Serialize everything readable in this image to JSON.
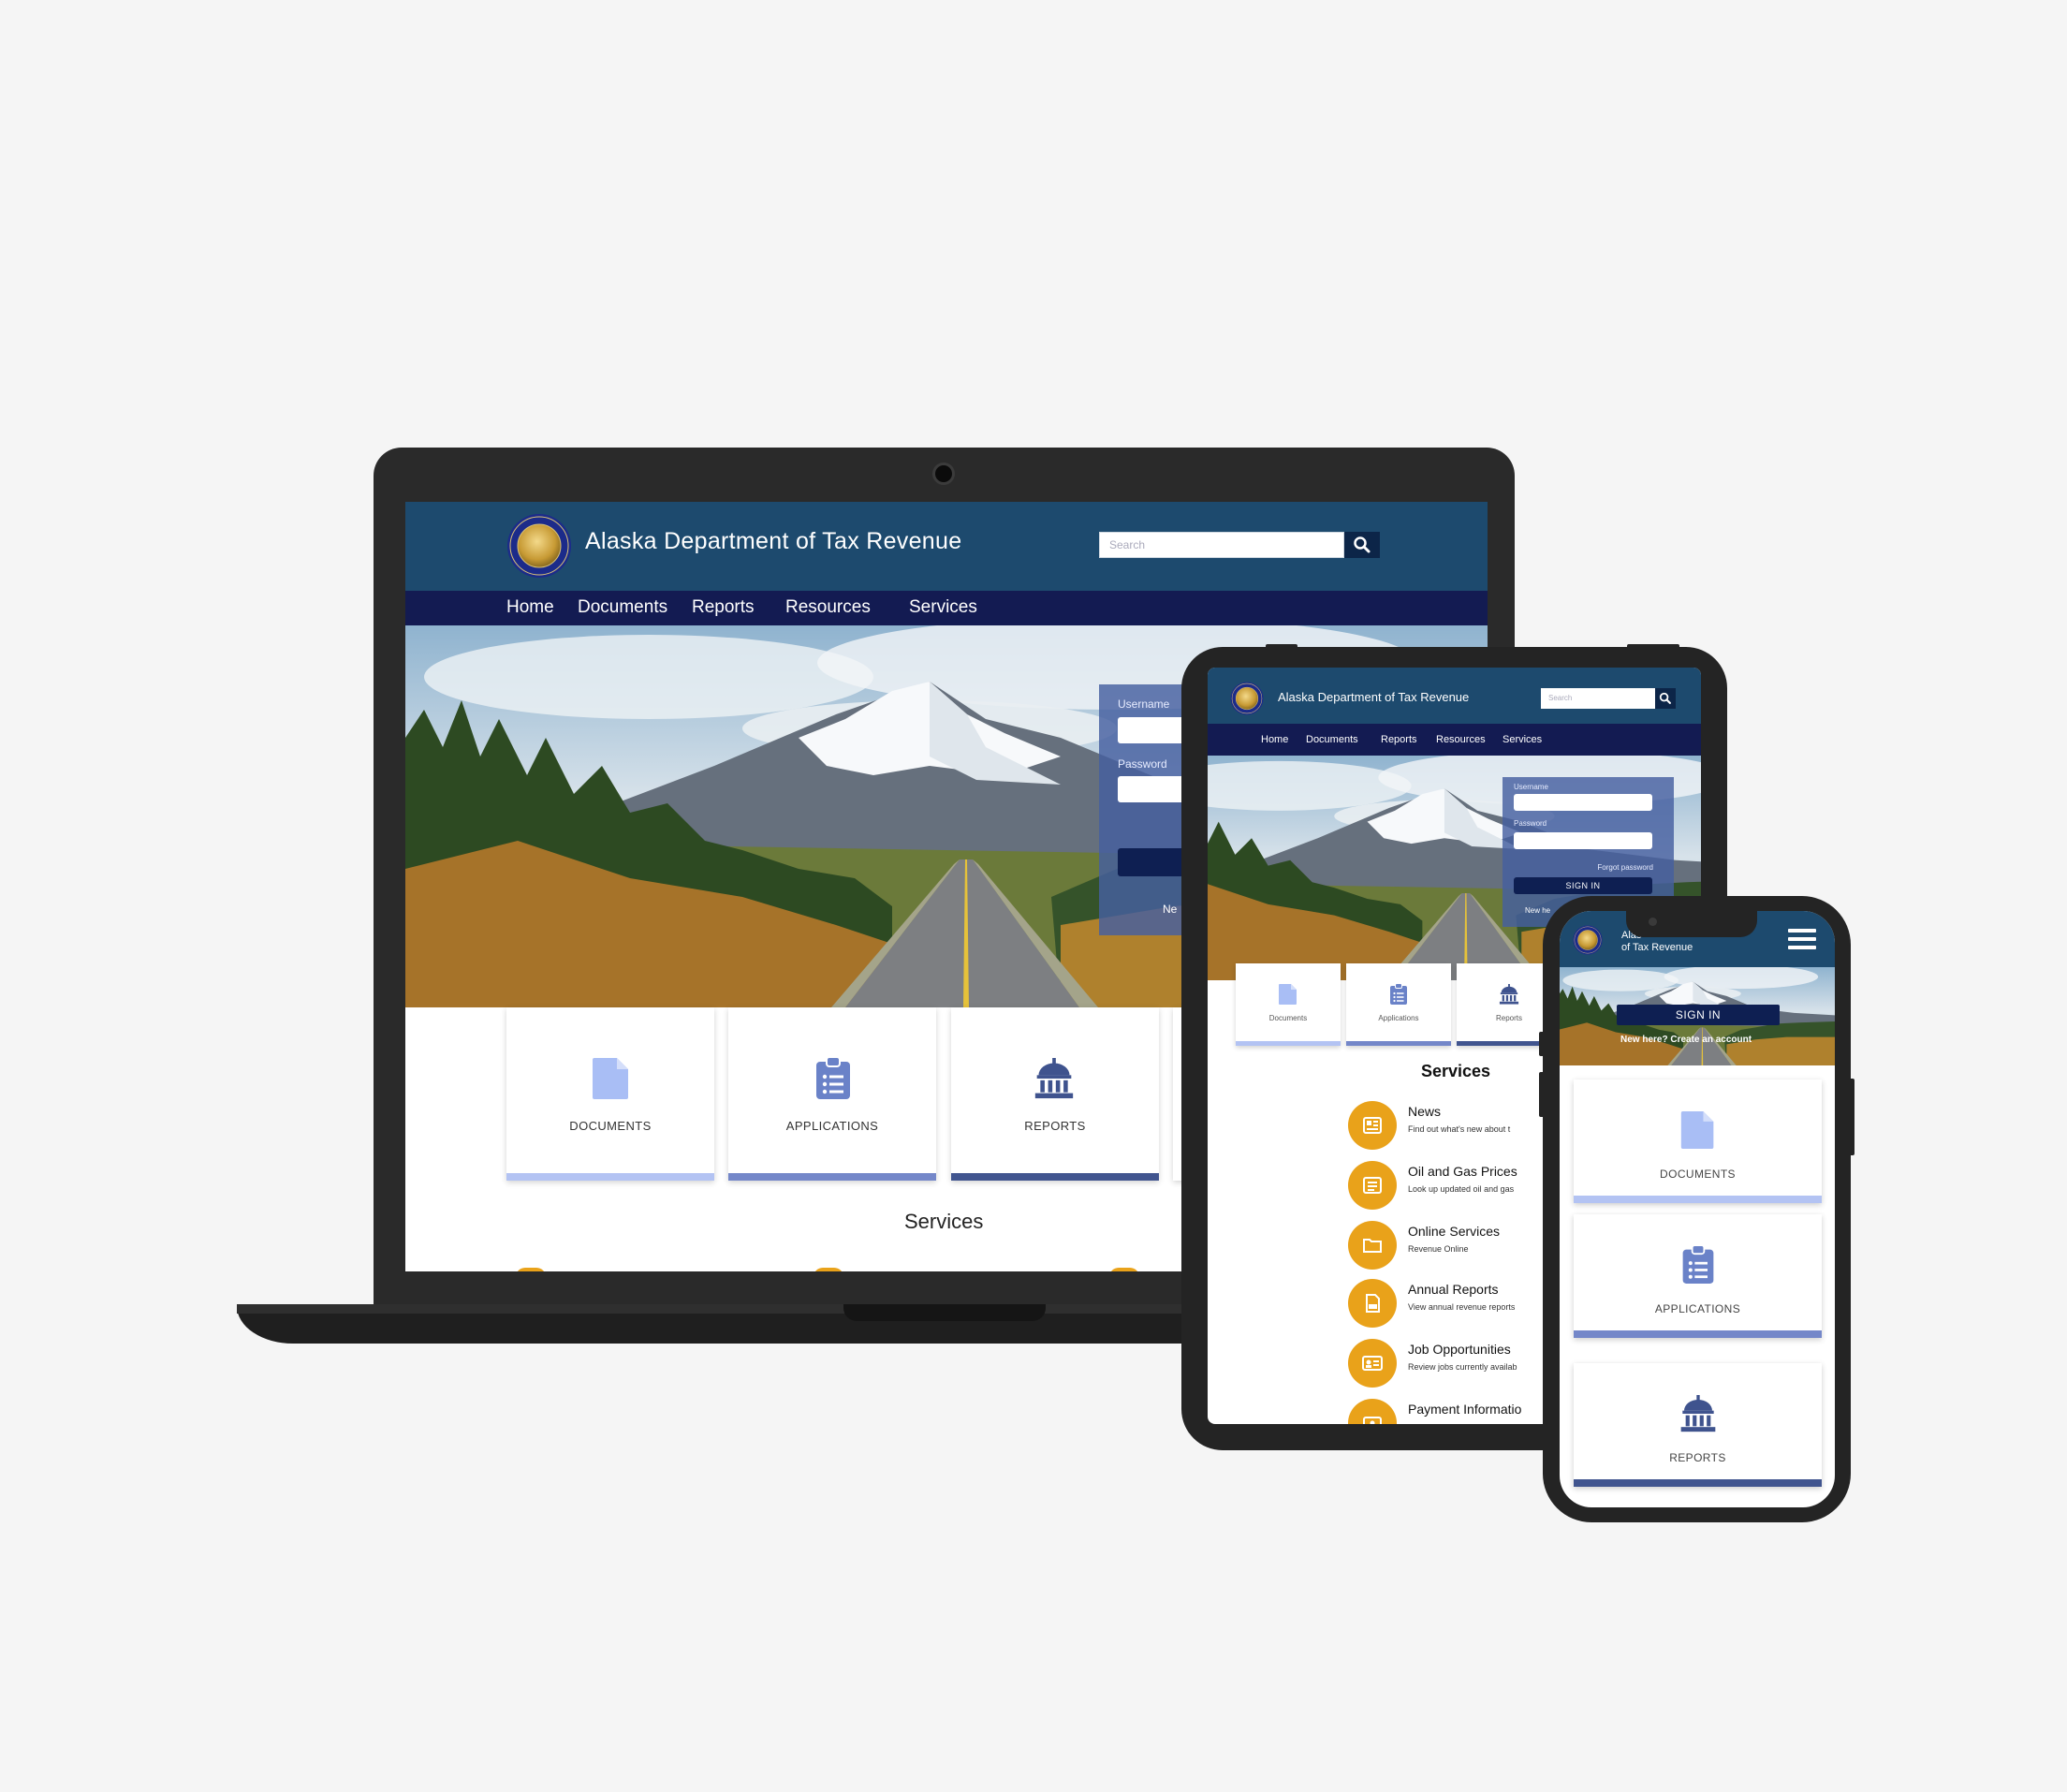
{
  "site": {
    "title": "Alaska Department of Tax Revenue",
    "phone_title_line1": "Alas",
    "phone_title_line2": "of Tax Revenue",
    "search_placeholder": "Search"
  },
  "nav": [
    "Home",
    "Documents",
    "Reports",
    "Resources",
    "Services"
  ],
  "login": {
    "username_label": "Username",
    "password_label": "Password",
    "forgot": "Forgot password",
    "sign_in": "SIGN IN",
    "new_here_short": "Ne",
    "new_here_tablet": "New he",
    "new_here_full": "New here? Create an account"
  },
  "cards": {
    "documents": "DOCUMENTS",
    "applications": "APPLICATIONS",
    "reports": "REPORTS",
    "documents_small": "Documents",
    "applications_small": "Applications",
    "reports_small": "Reports"
  },
  "services_heading": "Services",
  "services": [
    {
      "title": "News",
      "desc": "Find out what's new about t"
    },
    {
      "title": "Oil and Gas Prices",
      "desc": "Look up updated oil and gas"
    },
    {
      "title": "Online Services",
      "desc": "Revenue Online"
    },
    {
      "title": "Annual Reports",
      "desc": "View annual revenue reports"
    },
    {
      "title": "Job Opportunities",
      "desc": "Review jobs currently availab"
    },
    {
      "title": "Payment Informatio",
      "desc": ""
    }
  ],
  "colors": {
    "header_blue": "#1d4a6e",
    "nav_navy": "#131b52",
    "accent_orange": "#e9a21a",
    "doc_icon": "#a9bef5",
    "app_icon": "#6a82c8",
    "rep_icon": "#3f538e"
  },
  "icons": {
    "search": "magnifier-icon",
    "menu": "hamburger-menu-icon",
    "documents": "file-icon",
    "applications": "clipboard-list-icon",
    "reports": "government-building-icon"
  }
}
